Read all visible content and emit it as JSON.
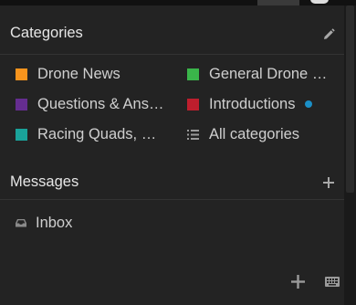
{
  "categories_section": {
    "title": "Categories",
    "edit_icon": "pencil-icon"
  },
  "categories": [
    {
      "label": "Drone News",
      "color": "#f7941d"
    },
    {
      "label": "General Drone Discussion",
      "color": "#3ab54a"
    },
    {
      "label": "Questions & Answers",
      "color": "#652d90"
    },
    {
      "label": "Introductions",
      "color": "#be1e2d",
      "unread_dot_color": "#1b8fc7"
    },
    {
      "label": "Racing Quads, FPV",
      "color": "#1aa39a"
    },
    {
      "label": "All categories",
      "icon": "list-icon"
    }
  ],
  "messages_section": {
    "title": "Messages",
    "add_icon": "plus-icon"
  },
  "messages": {
    "inbox_label": "Inbox",
    "inbox_icon": "inbox-icon"
  },
  "footer": {
    "add_icon": "plus-icon",
    "keyboard_icon": "keyboard-icon"
  },
  "colors": {
    "panel_bg": "#232323",
    "text": "#cfcfcf",
    "heading": "#e6e6e6",
    "icon": "#9a9a9a"
  }
}
